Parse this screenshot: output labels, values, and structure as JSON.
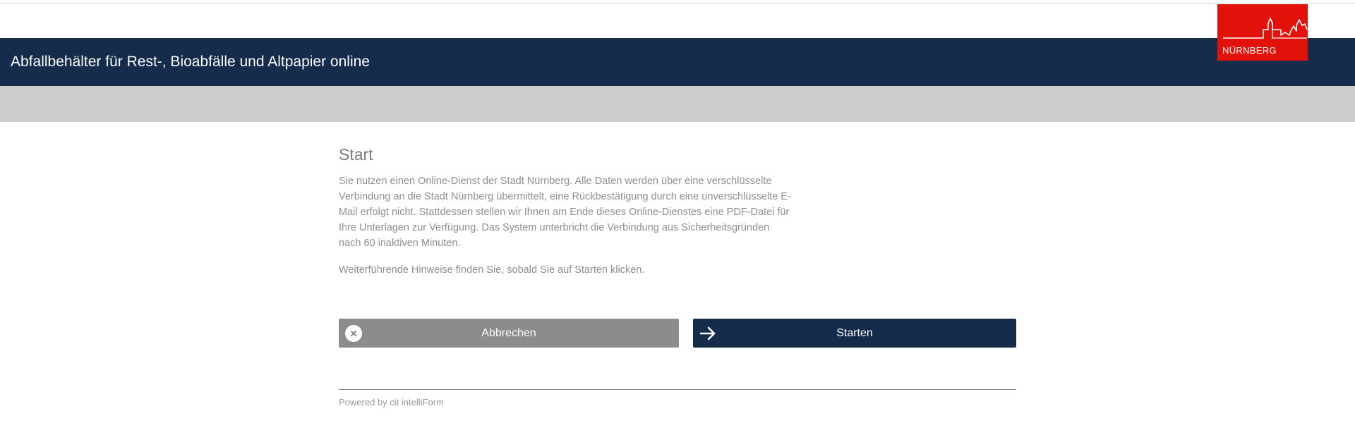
{
  "header": {
    "title": "Abfallbehälter für Rest-, Bioabfälle und Altpapier online",
    "logo_text": "NÜRNBERG",
    "background_color": "#152c4d",
    "logo_color": "#e2120b"
  },
  "main": {
    "title": "Start",
    "intro": "Sie nutzen einen Online-Dienst der Stadt Nürnberg. Alle Daten werden über eine verschlüs­selte Verbindung an die Stadt Nürnberg übermittelt, eine Rückbestätigung durch eine un­verschlüsselte E-Mail erfolgt nicht. Stattdessen stellen wir Ihnen am Ende dieses Online-Dienstes eine PDF-Datei für Ihre Unterlagen zur Verfügung. Das System unterbricht die Ver­bindung aus Sicherheitsgründen nach 60 inaktiven Minuten.",
    "hint": "Weiterführende Hinweise finden Sie, sobald Sie auf Starten klicken."
  },
  "buttons": {
    "cancel": {
      "label": "Abbrechen",
      "icon": "close-icon",
      "color": "#8c8c8c"
    },
    "start": {
      "label": "Starten",
      "icon": "arrow-right-icon",
      "color": "#152c4d"
    }
  },
  "footer": {
    "powered_by": "Powered by cit intelliForm"
  }
}
